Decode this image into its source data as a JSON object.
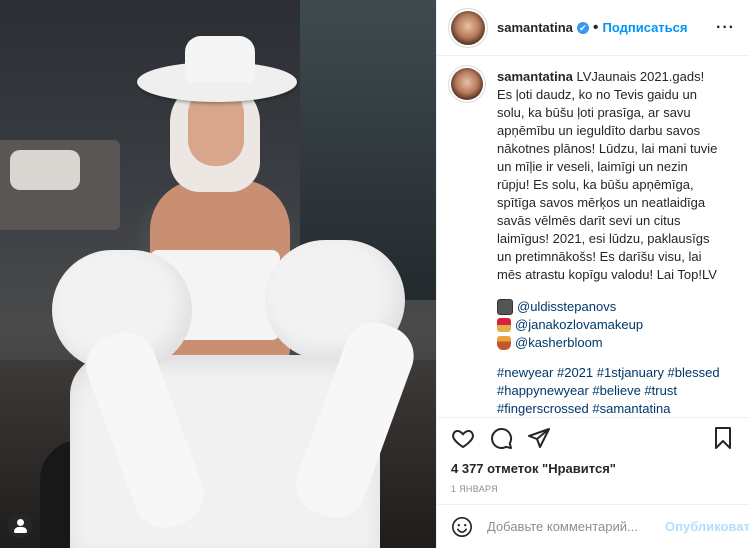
{
  "post": {
    "username": "samantatina",
    "verified_mark": "✔",
    "follow_label": "Подписаться",
    "dot": "•",
    "more_label": "···"
  },
  "caption": {
    "username": "samantatina",
    "lines": [
      "LVJaunais 2021.gads!",
      "Es ļoti daudz, ko no Tevis gaidu un",
      "solu, ka būšu ļoti prasīga, ar savu",
      "apņēmību un ieguldīto darbu savos",
      "nākotnes plānos! Lūdzu, lai mani tuvie",
      "un mīļie ir veseli, laimīgi un nezin",
      "rūpju! Es solu, ka būšu apņēmīga,",
      "spītīga savos mērķos un neatlaidīga",
      "savās vēlmēs darīt sevi un citus",
      "laimīgus! 2021, esi lūdzu, paklausīgs",
      "un pretimnākošs! Es darīšu visu, lai",
      "mēs atrastu kopīgu valodu! Lai Top!LV"
    ],
    "tags": [
      {
        "handle": "@uldisstepanovs",
        "emoji": "camera-emoji"
      },
      {
        "handle": "@janakozlovamakeup",
        "emoji": "lipstick-emoji"
      },
      {
        "handle": "@kasherbloom",
        "emoji": "dress-emoji"
      }
    ],
    "hashtags": [
      "#newyear #2021 #1stjanuary #blessed",
      "#happynewyear #believe #trust",
      "#fingerscrossed #samantatina"
    ]
  },
  "stats": {
    "likes": "4 377 отметок \"Нравится\"",
    "date": "1 ЯНВАРЯ"
  },
  "comment_box": {
    "placeholder": "Добавьте комментарий...",
    "publish_label": "Опубликовать"
  },
  "icons": {
    "like": "heart-icon",
    "comment": "comment-icon",
    "share": "share-icon",
    "save": "bookmark-icon",
    "emoji": "smile-icon",
    "tag": "user-tag-icon"
  },
  "colors": {
    "accent": "#0095f6",
    "verified": "#3897f0",
    "link": "#00376b",
    "publish_disabled": "#b2dffc",
    "muted": "#8e8e8e"
  }
}
